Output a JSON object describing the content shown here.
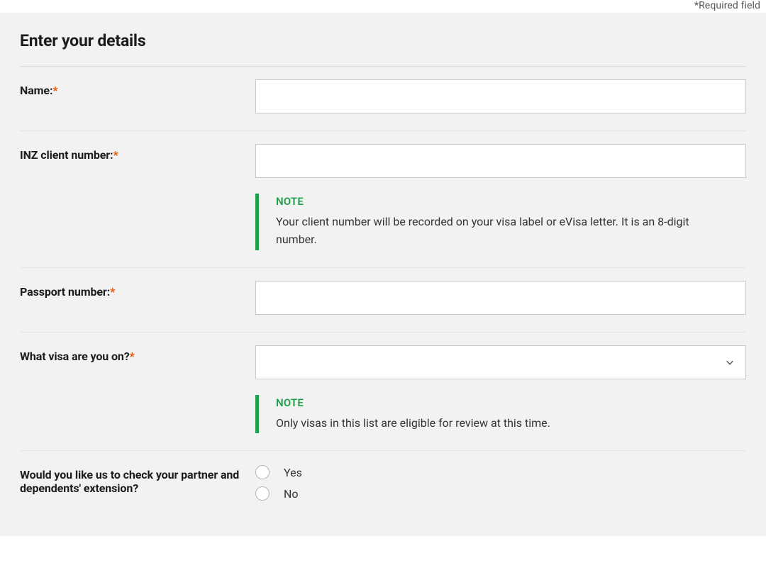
{
  "top_hint": "*Required field",
  "section_title": "Enter your details",
  "required_mark": "*",
  "fields": {
    "name": {
      "label": "Name:",
      "value": ""
    },
    "client_number": {
      "label": "INZ client number:",
      "value": ""
    },
    "passport": {
      "label": "Passport number:",
      "value": ""
    },
    "visa": {
      "label": "What visa are you on?",
      "value": ""
    },
    "partner": {
      "label": "Would you like us to check your partner and dependents' extension?"
    }
  },
  "notes": {
    "client_number": {
      "title": "NOTE",
      "text": "Your client number will be recorded on your visa label or eVisa letter. It is an 8-digit number."
    },
    "visa": {
      "title": "NOTE",
      "text": "Only visas in this list are eligible for review at this time."
    }
  },
  "radio_options": {
    "yes": "Yes",
    "no": "No"
  }
}
